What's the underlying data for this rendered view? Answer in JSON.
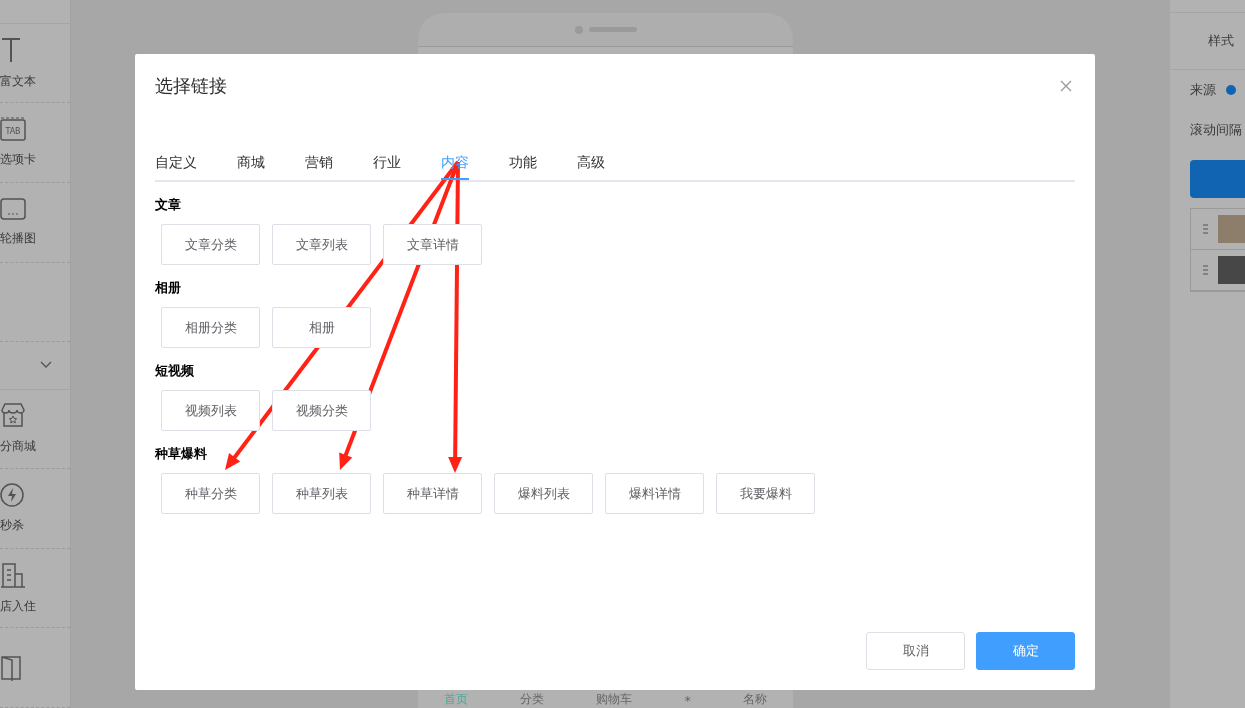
{
  "sidebar": {
    "tab_badge": "TAB",
    "items": [
      {
        "label": "富文本"
      },
      {
        "label": "选项卡"
      },
      {
        "label": "轮播图"
      },
      {
        "label": "分商城"
      },
      {
        "label": "秒杀"
      },
      {
        "label": "店入住"
      }
    ]
  },
  "preview": {
    "tabbar": [
      {
        "label": "首页",
        "selected": true
      },
      {
        "label": "分类",
        "selected": false
      },
      {
        "label": "购物车",
        "selected": false
      },
      {
        "label": "*",
        "selected": false
      },
      {
        "label": "名称",
        "selected": false
      }
    ]
  },
  "settings": {
    "tab": "样式",
    "fields": [
      "来源",
      "滚动间隔"
    ]
  },
  "dialog": {
    "title": "选择链接",
    "tabs": [
      {
        "label": "自定义",
        "selected": false
      },
      {
        "label": "商城",
        "selected": false
      },
      {
        "label": "营销",
        "selected": false
      },
      {
        "label": "行业",
        "selected": false
      },
      {
        "label": "内容",
        "selected": true
      },
      {
        "label": "功能",
        "selected": false
      },
      {
        "label": "高级",
        "selected": false
      }
    ],
    "sections": [
      {
        "heading": "文章",
        "links": [
          "文章分类",
          "文章列表",
          "文章详情"
        ]
      },
      {
        "heading": "相册",
        "links": [
          "相册分类",
          "相册"
        ]
      },
      {
        "heading": "短视频",
        "links": [
          "视频列表",
          "视频分类"
        ]
      },
      {
        "heading": "种草爆料",
        "links": [
          "种草分类",
          "种草列表",
          "种草详情",
          "爆料列表",
          "爆料详情",
          "我要爆料"
        ]
      }
    ],
    "buttons": [
      {
        "label": "取消",
        "kind": "secondary"
      },
      {
        "label": "确定",
        "kind": "primary"
      }
    ]
  }
}
